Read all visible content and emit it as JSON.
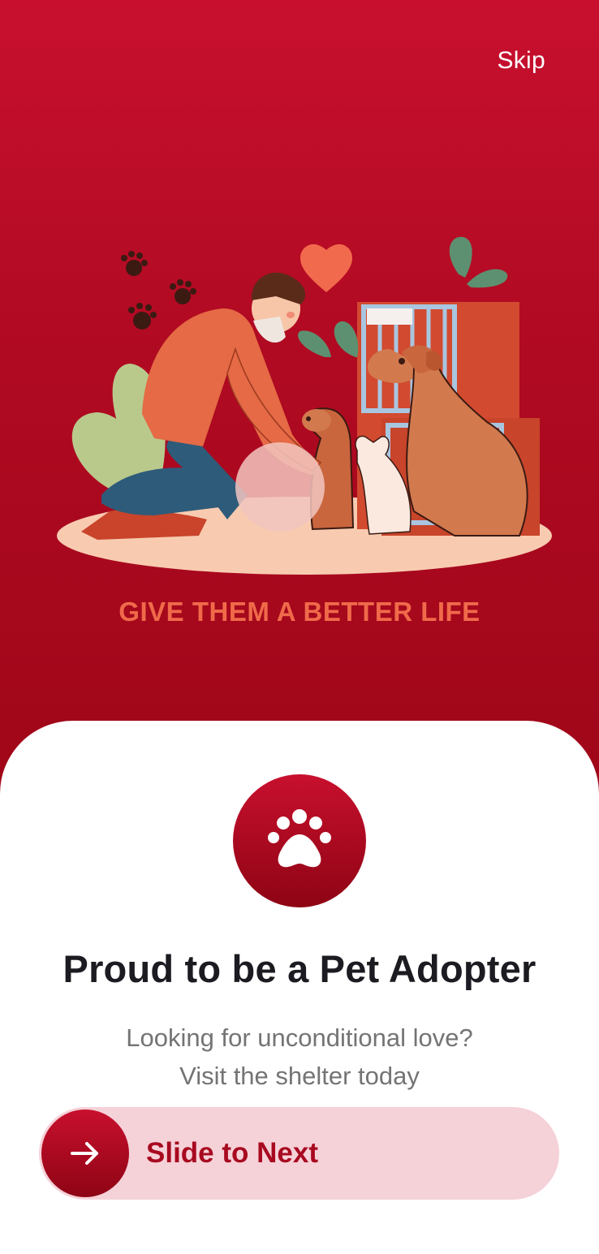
{
  "header": {
    "skip_label": "Skip"
  },
  "hero": {
    "tagline": "GIVE THEM A BETTER LIFE"
  },
  "onboarding": {
    "title": "Proud to be a Pet Adopter",
    "subtitle_line1": "Looking for unconditional love?",
    "subtitle_line2": "Visit the shelter today"
  },
  "slider": {
    "label": "Slide to Next"
  },
  "colors": {
    "primary": "#c8102e",
    "primary_dark": "#8e0414",
    "slider_track": "#f5d1d8",
    "tagline": "#f06a4a"
  },
  "icons": {
    "badge": "paw-icon",
    "slider_knob": "arrow-right-icon"
  }
}
